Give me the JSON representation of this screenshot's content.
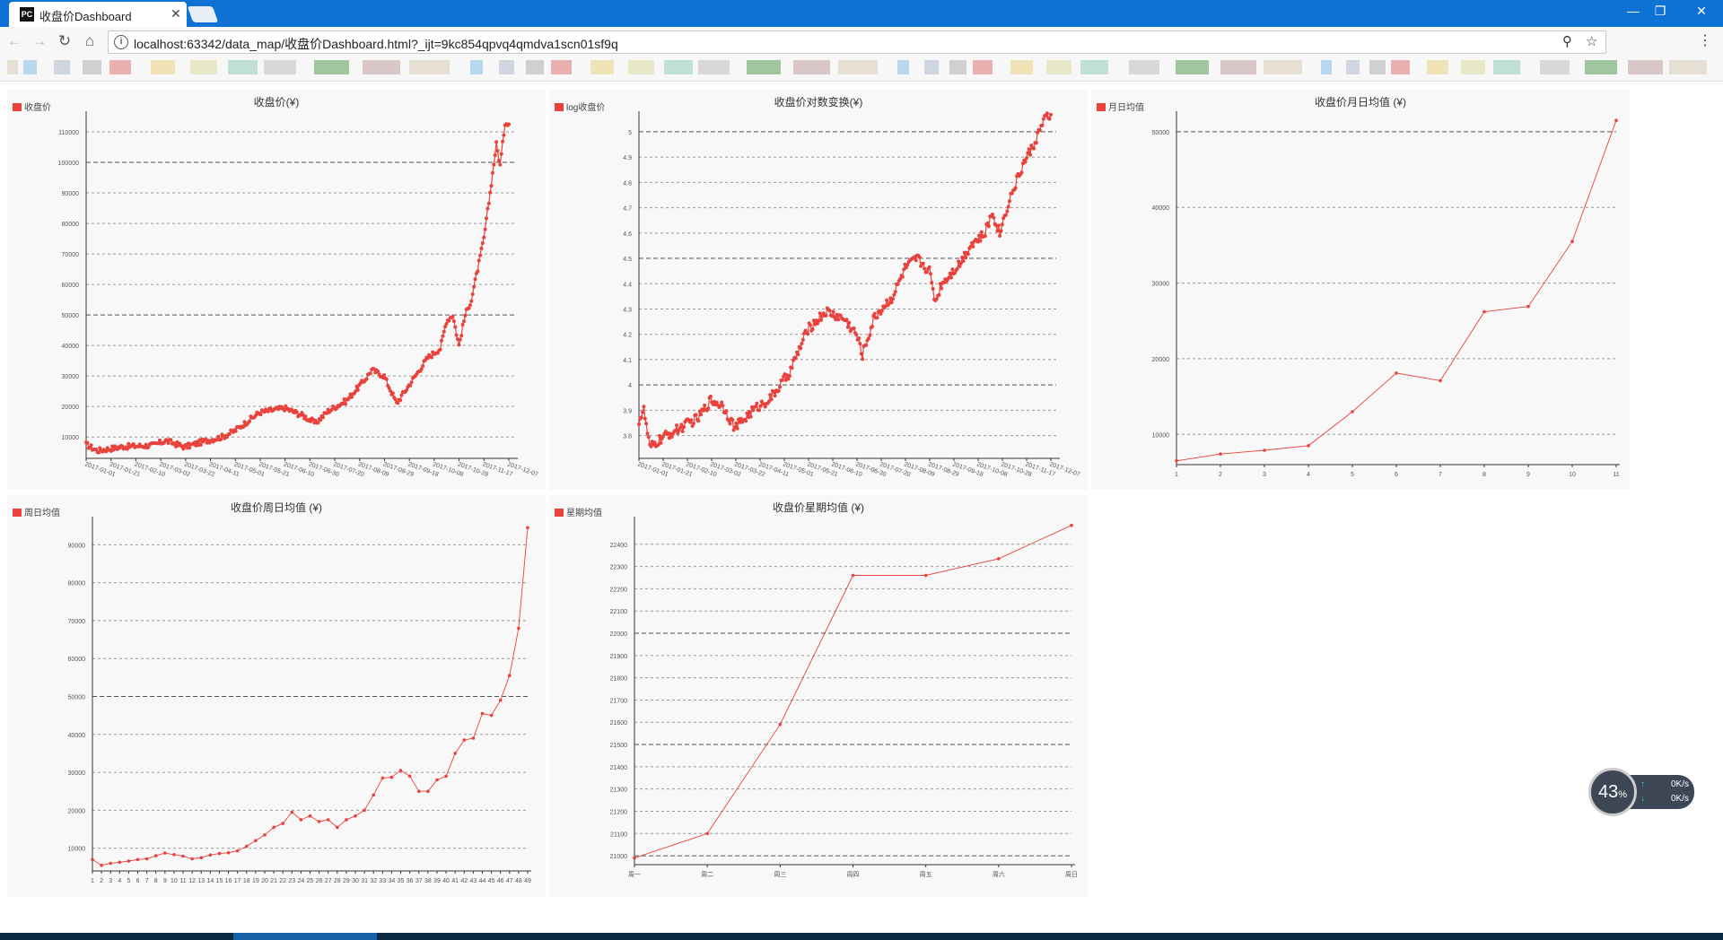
{
  "browser": {
    "tab_title": "收盘价Dashboard",
    "tab_icon_text": "PC",
    "url": "localhost:63342/data_map/收盘价Dashboard.html?_ijt=9kc854qpvq4qmdva1scn01sf9q",
    "titlebar_color": "#0e72d5"
  },
  "status_widget": {
    "percent": "43",
    "percent_unit": "%",
    "upload": "0K/s",
    "download": "0K/s",
    "upload_arrow": "↑",
    "download_arrow": "↓"
  },
  "colors": {
    "series": "#e9423c",
    "panel_bg": "#f8f8f8"
  },
  "chart_data": [
    {
      "type": "line",
      "title": "收盘价(¥)",
      "series_name": "收盘价",
      "x_ticks": [
        "2017-01-01",
        "2017-01-21",
        "2017-02-10",
        "2017-03-02",
        "2017-03-22",
        "2017-04-11",
        "2017-05-01",
        "2017-05-21",
        "2017-06-10",
        "2017-06-30",
        "2017-07-20",
        "2017-08-09",
        "2017-08-29",
        "2017-09-18",
        "2017-10-08",
        "2017-10-28",
        "2017-11-17",
        "2017-12-07"
      ],
      "y_ticks": [
        10000,
        20000,
        30000,
        40000,
        50000,
        60000,
        70000,
        80000,
        90000,
        100000,
        110000
      ],
      "ylim": [
        3000,
        115000
      ],
      "knots": [
        [
          1,
          7500
        ],
        [
          10,
          5500
        ],
        [
          30,
          6800
        ],
        [
          55,
          7300
        ],
        [
          65,
          8800
        ],
        [
          80,
          6700
        ],
        [
          95,
          8500
        ],
        [
          110,
          10000
        ],
        [
          120,
          12000
        ],
        [
          140,
          18000
        ],
        [
          160,
          19500
        ],
        [
          175,
          17000
        ],
        [
          185,
          14500
        ],
        [
          195,
          18500
        ],
        [
          210,
          22000
        ],
        [
          225,
          29000
        ],
        [
          230,
          32000
        ],
        [
          240,
          30000
        ],
        [
          250,
          21000
        ],
        [
          255,
          24000
        ],
        [
          265,
          30000
        ],
        [
          275,
          36000
        ],
        [
          285,
          39000
        ],
        [
          290,
          48000
        ],
        [
          295,
          50000
        ],
        [
          300,
          40000
        ],
        [
          305,
          50000
        ],
        [
          310,
          55000
        ],
        [
          315,
          65000
        ],
        [
          320,
          75000
        ],
        [
          325,
          90000
        ],
        [
          330,
          106000
        ],
        [
          333,
          99000
        ],
        [
          337,
          113000
        ]
      ],
      "noise": 900,
      "n": 340
    },
    {
      "type": "line",
      "title": "收盘价对数变换(¥)",
      "series_name": "log收盘价",
      "x_ticks": [
        "2017-01-01",
        "2017-01-21",
        "2017-02-10",
        "2017-03-02",
        "2017-03-22",
        "2017-04-11",
        "2017-05-01",
        "2017-05-21",
        "2017-06-10",
        "2017-06-30",
        "2017-07-20",
        "2017-08-09",
        "2017-08-29",
        "2017-09-18",
        "2017-10-08",
        "2017-10-28",
        "2017-11-17",
        "2017-12-07"
      ],
      "y_ticks": [
        3.8,
        3.9,
        4,
        4.1,
        4.2,
        4.3,
        4.4,
        4.5,
        4.6,
        4.7,
        4.8,
        4.9,
        5
      ],
      "ylim": [
        3.71,
        5.06
      ],
      "knots": [
        [
          1,
          3.86
        ],
        [
          5,
          3.9
        ],
        [
          10,
          3.75
        ],
        [
          20,
          3.79
        ],
        [
          35,
          3.83
        ],
        [
          50,
          3.87
        ],
        [
          60,
          3.94
        ],
        [
          70,
          3.92
        ],
        [
          80,
          3.83
        ],
        [
          95,
          3.9
        ],
        [
          110,
          3.95
        ],
        [
          125,
          4.05
        ],
        [
          140,
          4.22
        ],
        [
          155,
          4.29
        ],
        [
          170,
          4.26
        ],
        [
          180,
          4.2
        ],
        [
          185,
          4.12
        ],
        [
          195,
          4.27
        ],
        [
          210,
          4.35
        ],
        [
          220,
          4.46
        ],
        [
          230,
          4.5
        ],
        [
          240,
          4.45
        ],
        [
          245,
          4.33
        ],
        [
          250,
          4.4
        ],
        [
          265,
          4.48
        ],
        [
          275,
          4.56
        ],
        [
          285,
          4.59
        ],
        [
          292,
          4.68
        ],
        [
          298,
          4.6
        ],
        [
          305,
          4.72
        ],
        [
          318,
          4.88
        ],
        [
          326,
          4.95
        ],
        [
          332,
          5.02
        ],
        [
          337,
          5.06
        ]
      ],
      "noise": 0.02,
      "n": 340
    },
    {
      "type": "line",
      "title": "收盘价月日均值 (¥)",
      "series_name": "月日均值",
      "x": [
        1,
        2,
        3,
        4,
        5,
        6,
        7,
        8,
        9,
        10,
        11
      ],
      "x_ticks": [
        "1",
        "2",
        "3",
        "4",
        "5",
        "6",
        "7",
        "8",
        "9",
        "10",
        "11"
      ],
      "values": [
        6500,
        7400,
        7900,
        8500,
        13000,
        18100,
        17100,
        26200,
        26900,
        35500,
        51500
      ],
      "y_ticks": [
        10000,
        20000,
        30000,
        40000,
        50000
      ],
      "ylim": [
        6000,
        52000
      ]
    },
    {
      "type": "line",
      "title": "收盘价周日均值 (¥)",
      "series_name": "周日均值",
      "x": [
        1,
        2,
        3,
        4,
        5,
        6,
        7,
        8,
        9,
        10,
        11,
        12,
        13,
        14,
        15,
        16,
        17,
        18,
        19,
        20,
        21,
        22,
        23,
        24,
        25,
        26,
        27,
        28,
        29,
        30,
        31,
        32,
        33,
        34,
        35,
        36,
        37,
        38,
        39,
        40,
        41,
        42,
        43,
        44,
        45,
        46,
        47,
        48,
        49
      ],
      "x_ticks": [
        "1",
        "2",
        "3",
        "4",
        "5",
        "6",
        "7",
        "8",
        "9",
        "10",
        "11",
        "12",
        "13",
        "14",
        "15",
        "16",
        "17",
        "18",
        "19",
        "20",
        "21",
        "22",
        "23",
        "24",
        "25",
        "26",
        "27",
        "28",
        "29",
        "30",
        "31",
        "32",
        "33",
        "34",
        "35",
        "36",
        "37",
        "38",
        "39",
        "40",
        "41",
        "42",
        "43",
        "44",
        "45",
        "46",
        "47",
        "48",
        "49"
      ],
      "values": [
        7000,
        5500,
        6000,
        6300,
        6600,
        7000,
        7200,
        8000,
        8700,
        8300,
        7900,
        7200,
        7500,
        8200,
        8600,
        8800,
        9300,
        10500,
        12000,
        13500,
        15500,
        16500,
        19500,
        17500,
        18500,
        17000,
        17500,
        15500,
        17500,
        18500,
        20000,
        24000,
        28500,
        28700,
        30500,
        29000,
        25000,
        25000,
        28000,
        29000,
        35000,
        38500,
        39000,
        45500,
        45000,
        49000,
        55500,
        68000,
        94500
      ],
      "y_ticks": [
        10000,
        20000,
        30000,
        40000,
        50000,
        60000,
        70000,
        80000,
        90000
      ],
      "ylim": [
        4000,
        96000
      ]
    },
    {
      "type": "line",
      "title": "收盘价星期均值 (¥)",
      "series_name": "星期均值",
      "categories": [
        "周一",
        "周二",
        "周三",
        "周四",
        "周五",
        "周六",
        "周日"
      ],
      "values": [
        20990,
        21100,
        21590,
        22260,
        22260,
        22335,
        22485
      ],
      "y_ticks": [
        21000,
        21100,
        21200,
        21300,
        21400,
        21500,
        21600,
        21700,
        21800,
        21900,
        22000,
        22100,
        22200,
        22300,
        22400
      ],
      "ylim": [
        20960,
        22500
      ]
    }
  ]
}
